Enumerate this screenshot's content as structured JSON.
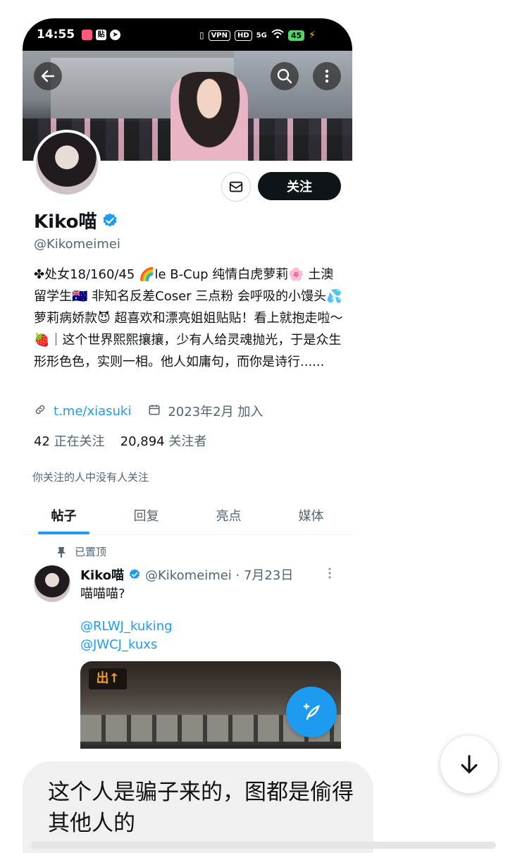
{
  "status_bar": {
    "time": "14:55",
    "left_icons": [
      "app-icon-pink",
      "app-icon-tag",
      "telegram-icon"
    ],
    "vpn": "VPN",
    "hd": "HD",
    "network": "5G",
    "battery": "45"
  },
  "header": {
    "back_icon": "arrow-left-icon",
    "search_icon": "search-icon",
    "more_icon": "more-vertical-icon"
  },
  "profile": {
    "follow_label": "关注",
    "message_icon": "envelope-icon",
    "name": "Kiko喵",
    "verified": true,
    "handle": "@Kikomeimei",
    "bio": "✤处女18/160/45 🌈le B-Cup 纯情白虎萝莉🌸 土澳留学生🇦🇺 非知名反差Coser 三点粉 会呼吸的小馒头💦 萝莉病娇款😈 超喜欢和漂亮姐姐贴贴！看上就抱走啦～🍓｜这个世界熙熙攘攘，少有人给灵魂抛光，于是众生形形色色，实则一相。他人如庸句，而你是诗行......",
    "link": "t.me/xiasuki",
    "joined": "2023年2月 加入",
    "following_count": "42",
    "following_label": "正在关注",
    "followers_count": "20,894",
    "followers_label": "关注者",
    "mutual_text": "你关注的人中没有人关注"
  },
  "tabs": [
    {
      "label": "帖子",
      "active": true
    },
    {
      "label": "回复",
      "active": false
    },
    {
      "label": "亮点",
      "active": false
    },
    {
      "label": "媒体",
      "active": false
    }
  ],
  "pinned_tweet": {
    "pinned_label": "已置顶",
    "author": "Kiko喵",
    "handle_date": "@Kikomeimei · 7月23日",
    "text": "喵喵喵?",
    "mentions": [
      "@RLWJ_kuking",
      "@JWCJ_kuxs"
    ],
    "media_sign": "出↑"
  },
  "compose_fab_icon": "compose-feather-icon",
  "scroll_down_icon": "arrow-down-icon",
  "chat_bubble": {
    "text": "这个人是骗子来的，图都是偷得其他人的"
  },
  "colors": {
    "accent": "#1d9bf0",
    "text_primary": "#0f1419",
    "text_secondary": "#536471",
    "follow_button": "#0f1419"
  }
}
